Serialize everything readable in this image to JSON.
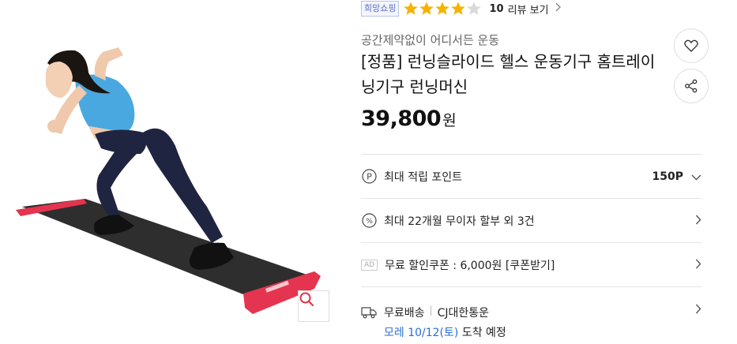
{
  "product": {
    "badge": "희망쇼핑",
    "rating": {
      "value": 4,
      "max": 5
    },
    "review_count": "10",
    "review_label": "리뷰 보기",
    "subtitle": "공간제약없이 어디서든 운동",
    "title": "[정품] 런닝슬라이드 헬스 운동기구 홈트레이닝기구 런닝머신",
    "price": "39,800",
    "price_unit": "원"
  },
  "benefits": {
    "points_label": "최대 적립 포인트",
    "points_value": "150P",
    "installment_label": "최대 22개월 무이자 할부 외 3건",
    "coupon_ad": "AD",
    "coupon_label": "무료 할인쿠폰 : 6,000원 [쿠폰받기]",
    "shipping_label": "무료배송",
    "shipping_carrier": "CJ대한통운",
    "eta_date": "모레 10/12(토)",
    "eta_rest": " 도착 예정"
  },
  "icons": {
    "wishlist": "heart-icon",
    "share": "share-icon",
    "zoom": "magnifier-icon",
    "points": "point-p-icon",
    "installment": "percent-icon",
    "shipping": "truck-icon"
  },
  "colors": {
    "star": "#f5b301",
    "star_empty": "#d9d9d9",
    "accent_pink": "#e4344f",
    "eta_blue": "#2a6fd6",
    "badge_blue": "#5b6fc2"
  }
}
